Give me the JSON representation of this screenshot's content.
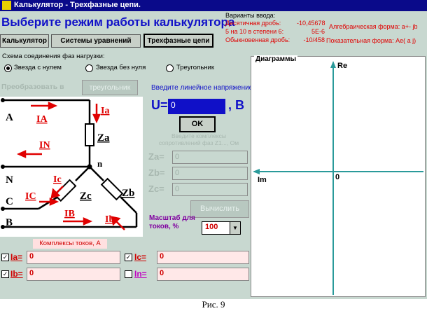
{
  "window": {
    "title": "Калькулятор - Трехфазные цепи."
  },
  "headline": "Выберите режим работы калькулятора",
  "tabs": [
    "Калькулятор",
    "Системы уравнений",
    "Трехфазные цепи"
  ],
  "input_variants": {
    "title": "Варианты ввода:",
    "rows": [
      {
        "label": "Десятичная дробь:",
        "value": "-10,45678"
      },
      {
        "label": "5 на 10 в степени 6:",
        "value": "5E-6"
      },
      {
        "label": "Обыкновенная дробь:",
        "value": "-10/458"
      }
    ],
    "algebraic": "Алгебраическая форма: a+- jb",
    "exponential": "Показательная форма: Ae( a j)"
  },
  "scheme": {
    "title": "Схема соединения фаз нагрузки:",
    "options": [
      "Звезда с нулем",
      "Звезда без нуля",
      "Треугольник"
    ],
    "selected": 0,
    "convert_label": "Преобразовать в",
    "convert_button": "треугольник"
  },
  "circuit": {
    "nodes": [
      "A",
      "N",
      "C",
      "B",
      "n"
    ],
    "currents": [
      "Ia",
      "IA",
      "IN",
      "Ic",
      "IC",
      "IB",
      "Ib"
    ],
    "impedances": [
      "Za",
      "Zc",
      "Zb"
    ]
  },
  "voltage": {
    "prompt": "Введите линейное напряжение",
    "label": "U=",
    "value": "0",
    "unit": ", B",
    "ok": "OK"
  },
  "impedance": {
    "prompt": "Введите комплексы сопротивлений фаз Z1..., Ом",
    "rows": [
      {
        "label": "Za=",
        "value": "0"
      },
      {
        "label": "Zb=",
        "value": "0"
      },
      {
        "label": "Zc=",
        "value": "0"
      }
    ]
  },
  "compute_button": "Вычислить",
  "scale": {
    "label": "Масштаб для токов, %",
    "value": "100"
  },
  "currents_panel": {
    "title": "Комплексы токов, А",
    "rows": [
      {
        "label": "Ia=",
        "value": "0",
        "checked": true
      },
      {
        "label": "Ic=",
        "value": "0",
        "checked": true
      },
      {
        "label": "Ib=",
        "value": "0",
        "checked": true
      },
      {
        "label": "In=",
        "value": "0",
        "checked": false
      }
    ]
  },
  "diagram": {
    "title": "Диаграммы",
    "axis_re": "Re",
    "axis_im": "Im",
    "origin": "0"
  },
  "caption": "Рис. 9",
  "colors": {
    "titlebar": "#0a0a8a",
    "client": "#c8d8d0",
    "accent_red": "#d00000",
    "axis": "#2a9a9a",
    "current_arrows": "#e00000"
  }
}
